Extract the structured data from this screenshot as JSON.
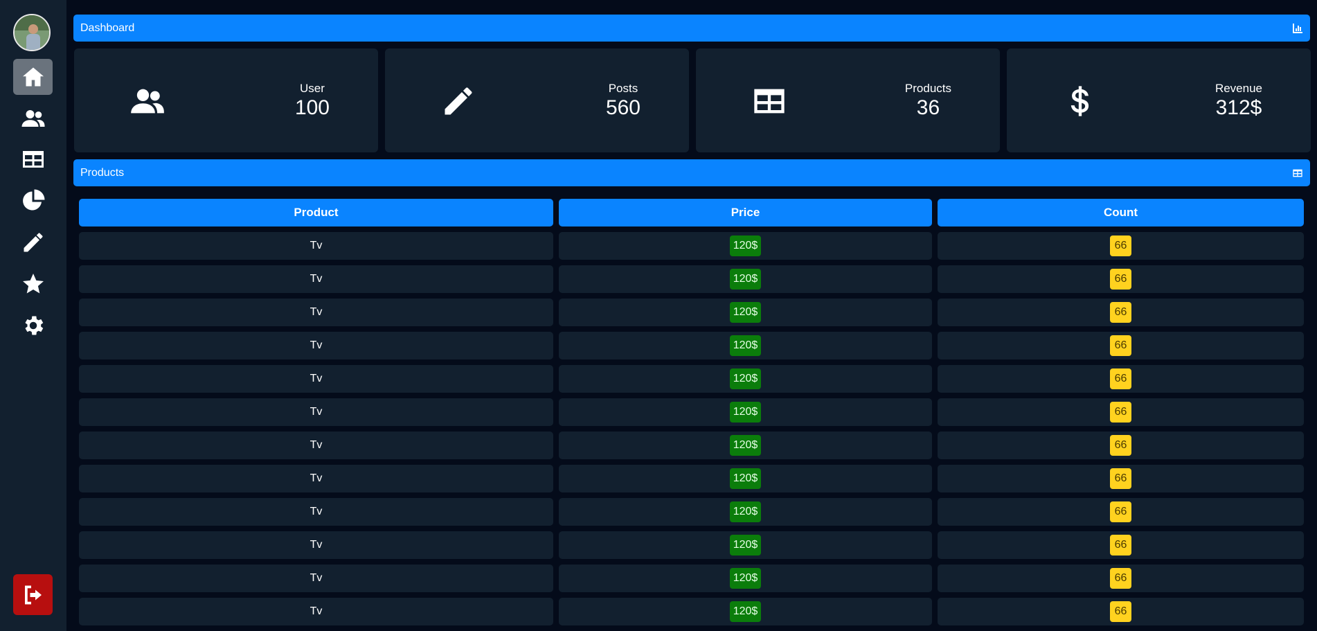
{
  "header": {
    "title": "Dashboard",
    "icon": "chart-icon"
  },
  "sidebar": {
    "avatar": "user-avatar",
    "items": [
      {
        "name": "home-icon",
        "active": true
      },
      {
        "name": "users-icon",
        "active": false
      },
      {
        "name": "table-icon",
        "active": false
      },
      {
        "name": "pie-chart-icon",
        "active": false
      },
      {
        "name": "pencil-icon",
        "active": false
      },
      {
        "name": "star-icon",
        "active": false
      },
      {
        "name": "gear-icon",
        "active": false
      }
    ],
    "logout": "logout-icon"
  },
  "stats": [
    {
      "label": "User",
      "value": "100",
      "icon": "users-icon"
    },
    {
      "label": "Posts",
      "value": "560",
      "icon": "pencil-icon"
    },
    {
      "label": "Products",
      "value": "36",
      "icon": "table-icon"
    },
    {
      "label": "Revenue",
      "value": "312$",
      "icon": "dollar-icon"
    }
  ],
  "products_section": {
    "title": "Products",
    "icon": "table-icon"
  },
  "table": {
    "headers": [
      "Product",
      "Price",
      "Count"
    ],
    "rows": [
      {
        "product": "Tv",
        "price": "120$",
        "count": "66"
      },
      {
        "product": "Tv",
        "price": "120$",
        "count": "66"
      },
      {
        "product": "Tv",
        "price": "120$",
        "count": "66"
      },
      {
        "product": "Tv",
        "price": "120$",
        "count": "66"
      },
      {
        "product": "Tv",
        "price": "120$",
        "count": "66"
      },
      {
        "product": "Tv",
        "price": "120$",
        "count": "66"
      },
      {
        "product": "Tv",
        "price": "120$",
        "count": "66"
      },
      {
        "product": "Tv",
        "price": "120$",
        "count": "66"
      },
      {
        "product": "Tv",
        "price": "120$",
        "count": "66"
      },
      {
        "product": "Tv",
        "price": "120$",
        "count": "66"
      },
      {
        "product": "Tv",
        "price": "120$",
        "count": "66"
      },
      {
        "product": "Tv",
        "price": "120$",
        "count": "66"
      }
    ]
  },
  "colors": {
    "background": "#040b1a",
    "panel": "#12202f",
    "accent": "#0a84ff",
    "price_badge": "#0b7d0b",
    "count_badge": "#ffd21f",
    "logout": "#b70f0f"
  }
}
